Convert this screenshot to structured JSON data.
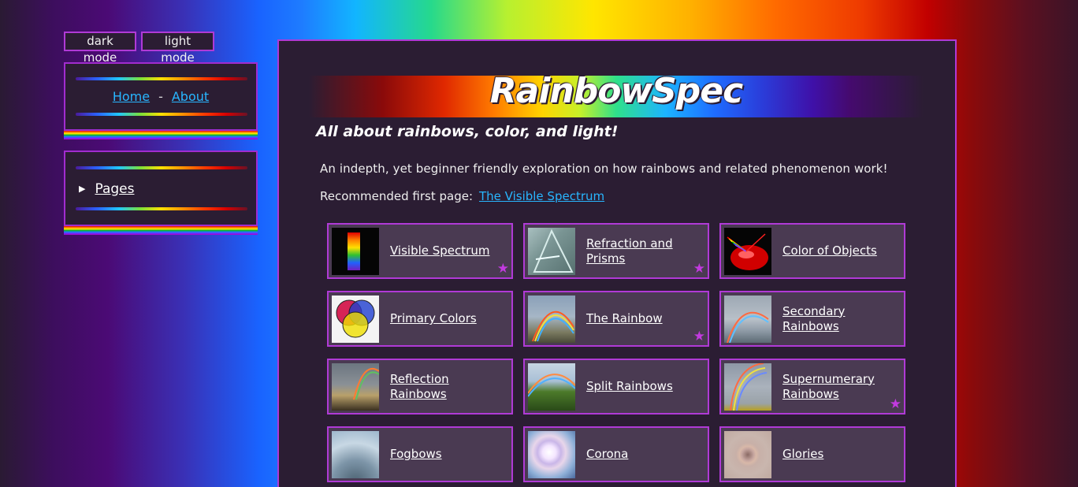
{
  "mode": {
    "dark_label": "dark mode",
    "light_label": "light mode"
  },
  "nav": {
    "home": "Home",
    "separator": "-",
    "about": "About"
  },
  "pages_menu": {
    "label": "Pages",
    "toggle_glyph": "▶"
  },
  "site": {
    "title": "RainbowSpec",
    "tagline": "All about rainbows, color, and light!",
    "intro": "An indepth, yet beginner friendly exploration on how rainbows and related phenomenon work!",
    "recommend_label": "Recommended first page:",
    "recommend_link": "The Visible Spectrum"
  },
  "cards": [
    {
      "label": "Visible Spectrum",
      "thumb": "spectrum-thumb",
      "starred": true
    },
    {
      "label": "Refraction and Prisms",
      "thumb": "prism-thumb",
      "starred": true
    },
    {
      "label": "Color of Objects",
      "thumb": "objects-thumb",
      "starred": false
    },
    {
      "label": "Primary Colors",
      "thumb": "primary-colors-thumb",
      "starred": false
    },
    {
      "label": "The Rainbow",
      "thumb": "rainbow-thumb",
      "starred": true
    },
    {
      "label": "Secondary Rainbows",
      "thumb": "secondary-rainbow-thumb",
      "starred": false
    },
    {
      "label": "Reflection Rainbows",
      "thumb": "reflection-rainbow-thumb",
      "starred": false
    },
    {
      "label": "Split Rainbows",
      "thumb": "split-rainbow-thumb",
      "starred": false
    },
    {
      "label": "Supernumerary Rainbows",
      "thumb": "supernumerary-thumb",
      "starred": true
    },
    {
      "label": "Fogbows",
      "thumb": "fogbow-thumb",
      "starred": false
    },
    {
      "label": "Corona",
      "thumb": "corona-thumb",
      "starred": false
    },
    {
      "label": "Glories",
      "thumb": "glory-thumb",
      "starred": false
    }
  ],
  "star_glyph": "★",
  "colors": {
    "accent": "#b03ad6",
    "panel": "#2b1d33",
    "card": "#4a3a52",
    "link": "#28b6ff",
    "star": "#c23adf"
  }
}
